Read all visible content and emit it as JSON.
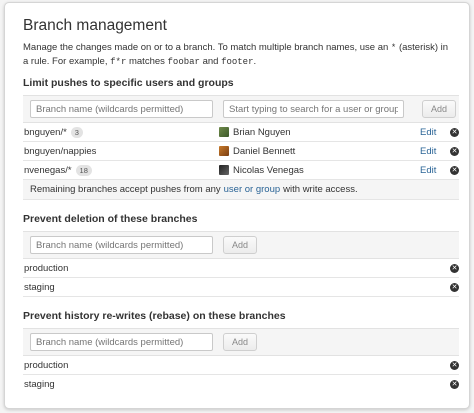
{
  "title": "Branch management",
  "description": {
    "line1": "Manage the changes made on or to a branch. To match multiple branch names, use an",
    "asterisk_code": "*",
    "line1_end": "(asterisk) in a rule. For",
    "line2_start": "example,",
    "example_pattern": "f*r",
    "matches_word": "matches",
    "example_match1": "foobar",
    "and_word": "and",
    "example_match2": "footer",
    "period": "."
  },
  "limit_pushes": {
    "heading": "Limit pushes to specific users and groups",
    "branch_placeholder": "Branch name (wildcards permitted)",
    "user_placeholder": "Start typing to search for a user or group",
    "add_label": "Add",
    "rows": [
      {
        "branch": "bnguyen/*",
        "badge": "3",
        "user": "Brian Nguyen",
        "edit": "Edit"
      },
      {
        "branch": "bnguyen/nappies",
        "badge": "",
        "user": "Daniel Bennett",
        "edit": "Edit"
      },
      {
        "branch": "nvenegas/*",
        "badge": "18",
        "user": "Nicolas Venegas",
        "edit": "Edit"
      }
    ],
    "note_prefix": "Remaining branches accept pushes from any",
    "note_link": "user or group",
    "note_suffix": "with write access."
  },
  "prevent_deletion": {
    "heading": "Prevent deletion of these branches",
    "branch_placeholder": "Branch name (wildcards permitted)",
    "add_label": "Add",
    "rows": [
      "production",
      "staging"
    ]
  },
  "prevent_rewrites": {
    "heading": "Prevent history re-writes (rebase) on these branches",
    "branch_placeholder": "Branch name (wildcards permitted)",
    "add_label": "Add",
    "rows": [
      "production",
      "staging"
    ]
  },
  "colors": {
    "link": "#2a6496",
    "close_icon": "#333333",
    "form_bg": "#f5f5f5"
  },
  "icons": {
    "remove": "close-icon",
    "user": "avatar"
  }
}
